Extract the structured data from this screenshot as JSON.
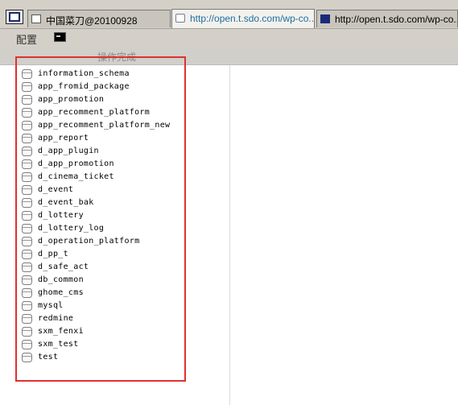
{
  "tabs": [
    {
      "label": "中国菜刀@20100928",
      "icon": "window-icon",
      "active": false
    },
    {
      "label": "http://open.t.sdo.com/wp-co...",
      "icon": "page-icon",
      "active": true
    },
    {
      "label": "http://open.t.sdo.com/wp-co...",
      "icon": "terminal-icon",
      "active": false
    }
  ],
  "menubar": {
    "config_label": "配置",
    "cmd_icon": "terminal-icon"
  },
  "status": {
    "text": "操作完成"
  },
  "databases": [
    "information_schema",
    "app_fromid_package",
    "app_promotion",
    "app_recomment_platform",
    "app_recomment_platform_new",
    "app_report",
    "d_app_plugin",
    "d_app_promotion",
    "d_cinema_ticket",
    "d_event",
    "d_event_bak",
    "d_lottery",
    "d_lottery_log",
    "d_operation_platform",
    "d_pp_t",
    "d_safe_act",
    "db_common",
    "ghome_cms",
    "mysql",
    "redmine",
    "sxm_fenxi",
    "sxm_test",
    "test"
  ],
  "colors": {
    "highlight": "#e03030",
    "active_tab_text": "#1d6fa3",
    "chrome": "#d4d0c8"
  }
}
